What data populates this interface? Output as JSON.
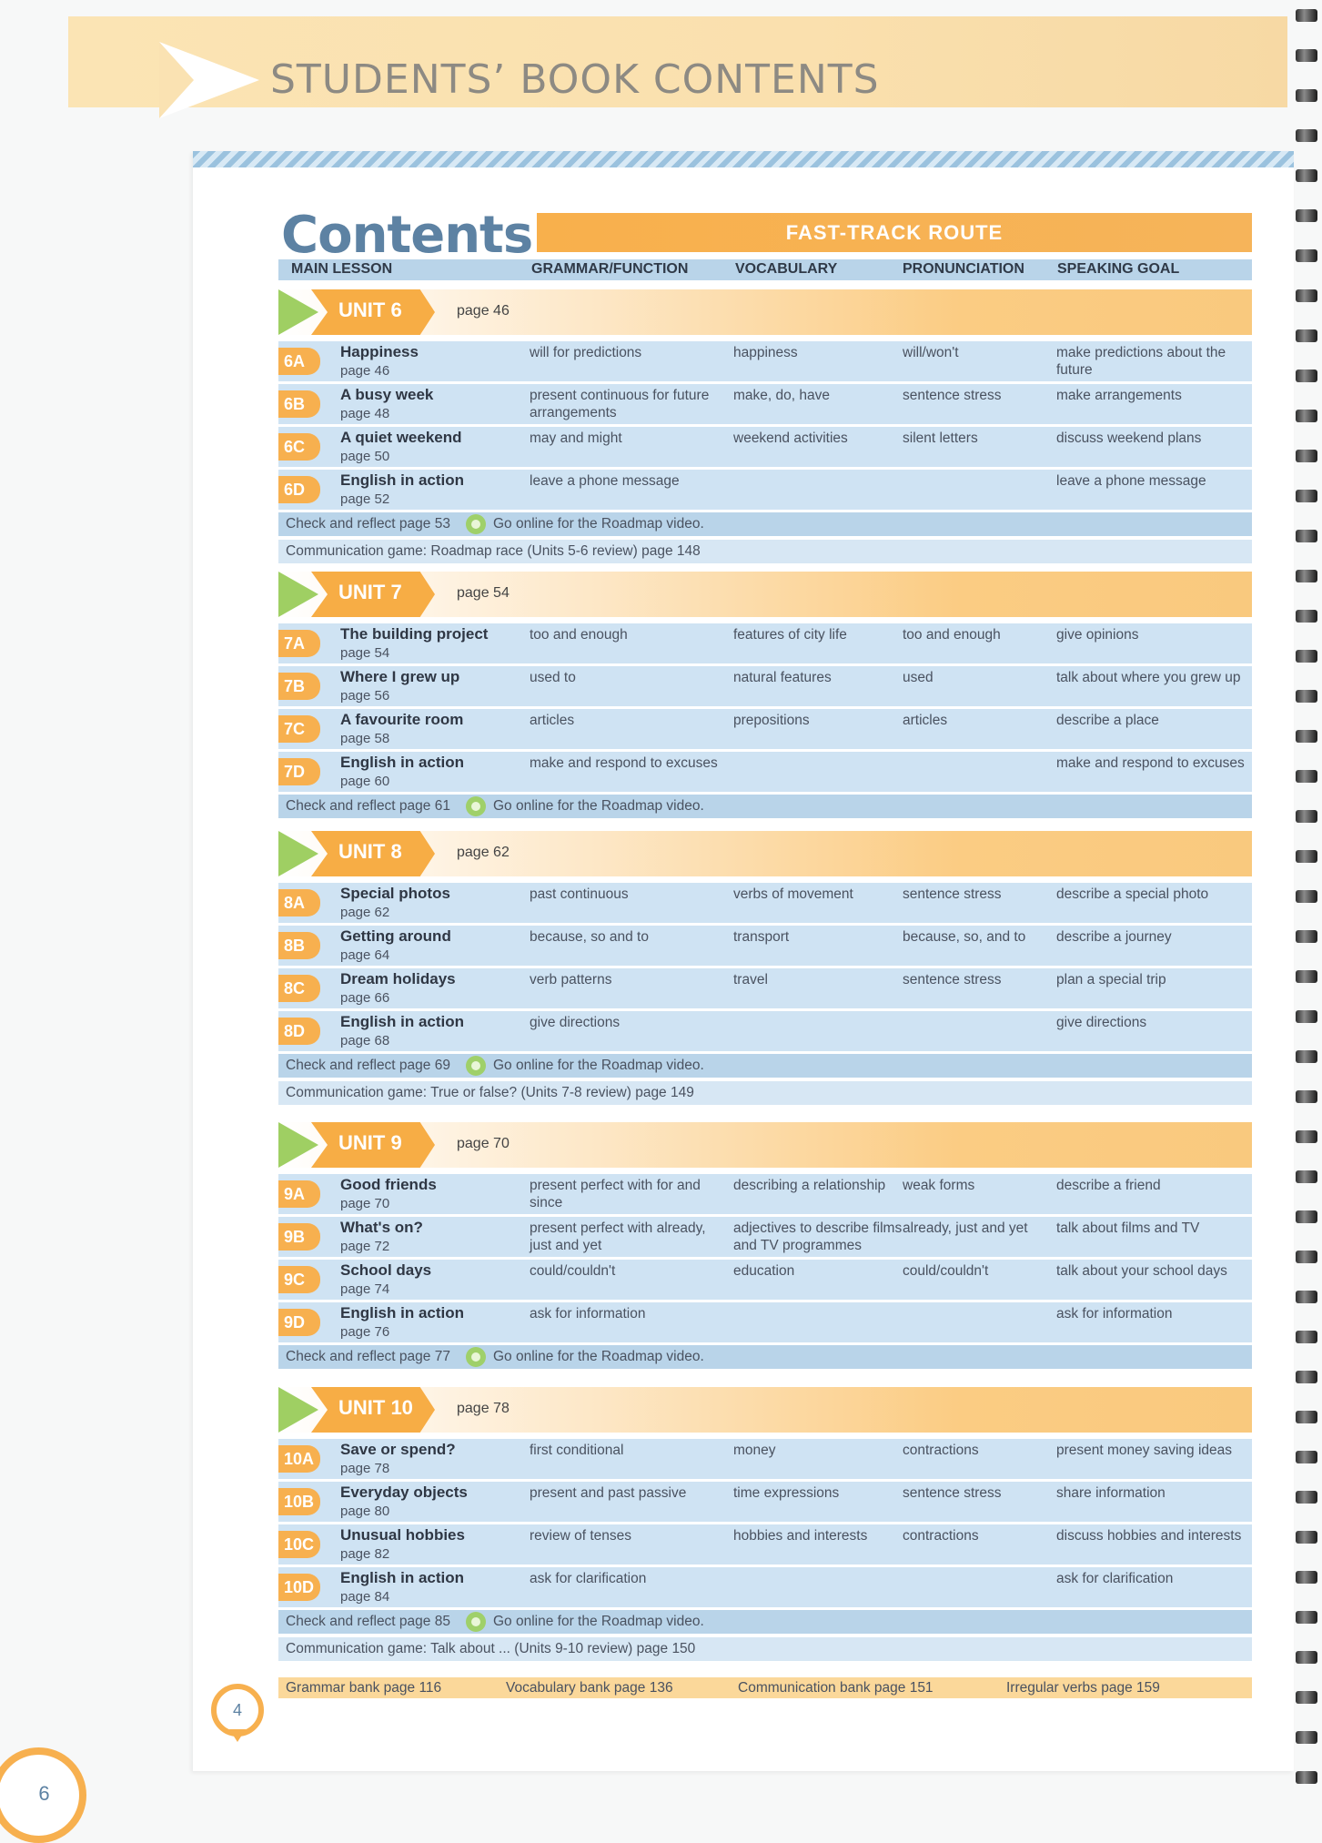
{
  "banner": {
    "title": "STUDENTS’ BOOK CONTENTS"
  },
  "contents": {
    "title": "Contents",
    "route": "FAST-TRACK ROUTE"
  },
  "columns": {
    "main": "MAIN LESSON",
    "grammar": "GRAMMAR/FUNCTION",
    "vocabulary": "VOCABULARY",
    "pronunciation": "PRONUNCIATION",
    "speaking": "SPEAKING GOAL"
  },
  "units": [
    {
      "label": "UNIT 6",
      "page": "page 46",
      "lessons": [
        {
          "code": "6A",
          "title": "Happiness",
          "page": "page 46",
          "grammar": "will for predictions",
          "vocabulary": "happiness",
          "pronunciation": "will/won't",
          "speaking": "make predictions about the future"
        },
        {
          "code": "6B",
          "title": "A busy week",
          "page": "page 48",
          "grammar": "present continuous for future arrangements",
          "vocabulary": "make, do, have",
          "pronunciation": "sentence stress",
          "speaking": "make arrangements"
        },
        {
          "code": "6C",
          "title": "A quiet weekend",
          "page": "page 50",
          "grammar": "may and might",
          "vocabulary": "weekend activities",
          "pronunciation": "silent letters",
          "speaking": "discuss weekend plans"
        },
        {
          "code": "6D",
          "title": "English in action",
          "page": "page 52",
          "grammar": "leave a phone message",
          "vocabulary": "",
          "pronunciation": "",
          "speaking": "leave a phone message"
        }
      ],
      "check": "Check and reflect page 53",
      "video": "Go online for the Roadmap video.",
      "comm": "Communication game: Roadmap race (Units 5-6 review) page 148"
    },
    {
      "label": "UNIT 7",
      "page": "page 54",
      "lessons": [
        {
          "code": "7A",
          "title": "The building project",
          "page": "page 54",
          "grammar": "too and enough",
          "vocabulary": "features of city life",
          "pronunciation": "too and enough",
          "speaking": "give opinions"
        },
        {
          "code": "7B",
          "title": "Where I grew up",
          "page": "page 56",
          "grammar": "used to",
          "vocabulary": "natural features",
          "pronunciation": "used",
          "speaking": "talk about where you grew up"
        },
        {
          "code": "7C",
          "title": "A favourite room",
          "page": "page 58",
          "grammar": "articles",
          "vocabulary": "prepositions",
          "pronunciation": "articles",
          "speaking": "describe a place"
        },
        {
          "code": "7D",
          "title": "English in action",
          "page": "page 60",
          "grammar": "make and respond to excuses",
          "vocabulary": "",
          "pronunciation": "",
          "speaking": "make and respond to excuses"
        }
      ],
      "check": "Check and reflect page 61",
      "video": "Go online for the Roadmap video.",
      "comm": ""
    },
    {
      "label": "UNIT 8",
      "page": "page 62",
      "lessons": [
        {
          "code": "8A",
          "title": "Special photos",
          "page": "page 62",
          "grammar": "past continuous",
          "vocabulary": "verbs of movement",
          "pronunciation": "sentence stress",
          "speaking": "describe a special photo"
        },
        {
          "code": "8B",
          "title": "Getting around",
          "page": "page 64",
          "grammar": "because, so and to",
          "vocabulary": "transport",
          "pronunciation": "because, so, and to",
          "speaking": "describe a journey"
        },
        {
          "code": "8C",
          "title": "Dream holidays",
          "page": "page 66",
          "grammar": "verb patterns",
          "vocabulary": "travel",
          "pronunciation": "sentence stress",
          "speaking": "plan a special trip"
        },
        {
          "code": "8D",
          "title": "English in action",
          "page": "page 68",
          "grammar": "give directions",
          "vocabulary": "",
          "pronunciation": "",
          "speaking": "give directions"
        }
      ],
      "check": "Check and reflect page 69",
      "video": "Go online for the Roadmap video.",
      "comm": "Communication game: True or false? (Units 7-8 review) page 149"
    },
    {
      "label": "UNIT 9",
      "page": "page 70",
      "lessons": [
        {
          "code": "9A",
          "title": "Good friends",
          "page": "page 70",
          "grammar": "present perfect with for and since",
          "vocabulary": "describing a relationship",
          "pronunciation": "weak forms",
          "speaking": "describe a friend"
        },
        {
          "code": "9B",
          "title": "What's on?",
          "page": "page 72",
          "grammar": "present perfect with already, just and yet",
          "vocabulary": "adjectives to describe films and TV programmes",
          "pronunciation": "already, just and yet",
          "speaking": "talk about films and TV"
        },
        {
          "code": "9C",
          "title": "School days",
          "page": "page 74",
          "grammar": "could/couldn't",
          "vocabulary": "education",
          "pronunciation": "could/couldn't",
          "speaking": "talk about your school days"
        },
        {
          "code": "9D",
          "title": "English in action",
          "page": "page 76",
          "grammar": "ask for information",
          "vocabulary": "",
          "pronunciation": "",
          "speaking": "ask for information"
        }
      ],
      "check": "Check and reflect page 77",
      "video": "Go online for the Roadmap video.",
      "comm": ""
    },
    {
      "label": "UNIT 10",
      "page": "page 78",
      "lessons": [
        {
          "code": "10A",
          "title": "Save or spend?",
          "page": "page 78",
          "grammar": "first conditional",
          "vocabulary": "money",
          "pronunciation": "contractions",
          "speaking": "present money saving ideas"
        },
        {
          "code": "10B",
          "title": "Everyday objects",
          "page": "page 80",
          "grammar": "present and past passive",
          "vocabulary": "time expressions",
          "pronunciation": "sentence stress",
          "speaking": "share information"
        },
        {
          "code": "10C",
          "title": "Unusual hobbies",
          "page": "page 82",
          "grammar": "review of tenses",
          "vocabulary": "hobbies and interests",
          "pronunciation": "contractions",
          "speaking": "discuss hobbies and interests"
        },
        {
          "code": "10D",
          "title": "English in action",
          "page": "page 84",
          "grammar": "ask for clarification",
          "vocabulary": "",
          "pronunciation": "",
          "speaking": "ask for clarification"
        }
      ],
      "check": "Check and reflect page 85",
      "video": "Go online for the Roadmap video.",
      "comm": "Communication game: Talk about ... (Units 9-10 review) page 150"
    }
  ],
  "footer": {
    "grammar": "Grammar bank page 116",
    "vocabulary": "Vocabulary bank page 136",
    "communication": "Communication bank page 151",
    "irregular": "Irregular verbs page 159"
  },
  "inner_page_number": "4",
  "page_number": "6",
  "colors": {
    "orange": "#f7b04f",
    "green": "#9fcf63",
    "blue_row": "#cfe3f3",
    "title_blue": "#5d82a3"
  }
}
